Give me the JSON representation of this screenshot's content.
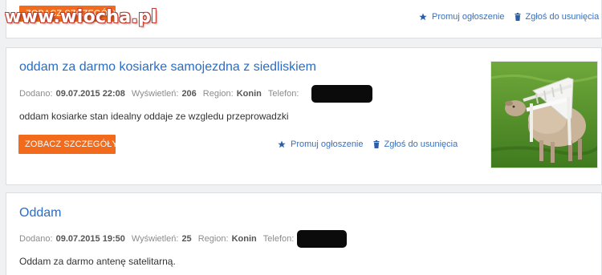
{
  "watermark": "www.wiocha.pl",
  "listings": [
    {
      "details_button": "ZOBACZ SZCZEGÓŁY",
      "promote": "Promuj ogłoszenie",
      "report": "Zgłoś do usunięcia"
    },
    {
      "title": "oddam za darmo kosiarke samojezdna z siedliskiem",
      "added_label": "Dodano:",
      "added_value": "09.07.2015 22:08",
      "views_label": "Wyświetleń:",
      "views_value": "206",
      "region_label": "Region:",
      "region_value": "Konin",
      "phone_label": "Telefon:",
      "description": "oddam kosiarke stan idealny oddaje ze wzgledu przeprowadzki",
      "details_button": "ZOBACZ SZCZEGÓŁY",
      "promote": "Promuj ogłoszenie",
      "report": "Zgłoś do usunięcia",
      "image": "photo of sheep carrying a white plastic garden chair on grass"
    },
    {
      "title": "Oddam",
      "added_label": "Dodano:",
      "added_value": "09.07.2015 19:50",
      "views_label": "Wyświetleń:",
      "views_value": "25",
      "region_label": "Region:",
      "region_value": "Konin",
      "phone_label": "Telefon:",
      "description": "Oddam za darmo antenę satelitarną."
    }
  ],
  "colors": {
    "accent_orange": "#f26a1b",
    "link_blue": "#2a6dc6",
    "action_blue": "#3a71b9",
    "background": "#f0f1f2"
  },
  "icons": [
    "star-icon",
    "trash-icon"
  ]
}
